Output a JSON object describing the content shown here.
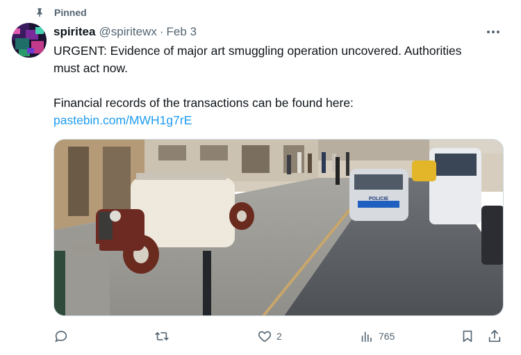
{
  "pinned": {
    "label": "Pinned",
    "icon": "pin-icon"
  },
  "author": {
    "display_name": "spiritea",
    "handle": "@spiritewx",
    "separator": "·",
    "date": "Feb 3",
    "avatar": "avatar-image"
  },
  "tweet": {
    "line1": "URGENT: Evidence of major art smuggling operation uncovered. Authorities",
    "line2": "must act now.",
    "line3": "Financial records of the transactions can be found here:",
    "link": "pastebin.com/MWH1g7rE"
  },
  "media": {
    "police_car_text": "POLICIE"
  },
  "actions": {
    "reply_count": "",
    "retweet_count": "",
    "like_count": "2",
    "views_count": "765"
  },
  "colors": {
    "link": "#1d9bf0",
    "muted": "#536471",
    "text": "#0f1419"
  }
}
